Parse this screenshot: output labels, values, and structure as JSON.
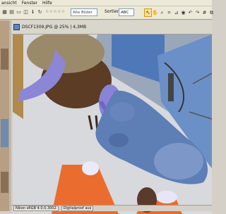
{
  "menu": {
    "items": [
      "ansicht",
      "Fenster",
      "Hilfe"
    ]
  },
  "toolbar": {
    "rating_stars": "☆☆☆☆☆",
    "filter_value": "Alle Bilder",
    "sort_label": "Sortieren",
    "sort_value": "ABC"
  },
  "window": {
    "title": "DSCF1309.JPG @ 25% | 4,3MB",
    "status": [
      "Nikon sRGB 4.0.0.3002",
      "Digitalproof aus"
    ]
  },
  "colors": {
    "accent": "#ffe08a",
    "brand": "#5a87c6"
  }
}
